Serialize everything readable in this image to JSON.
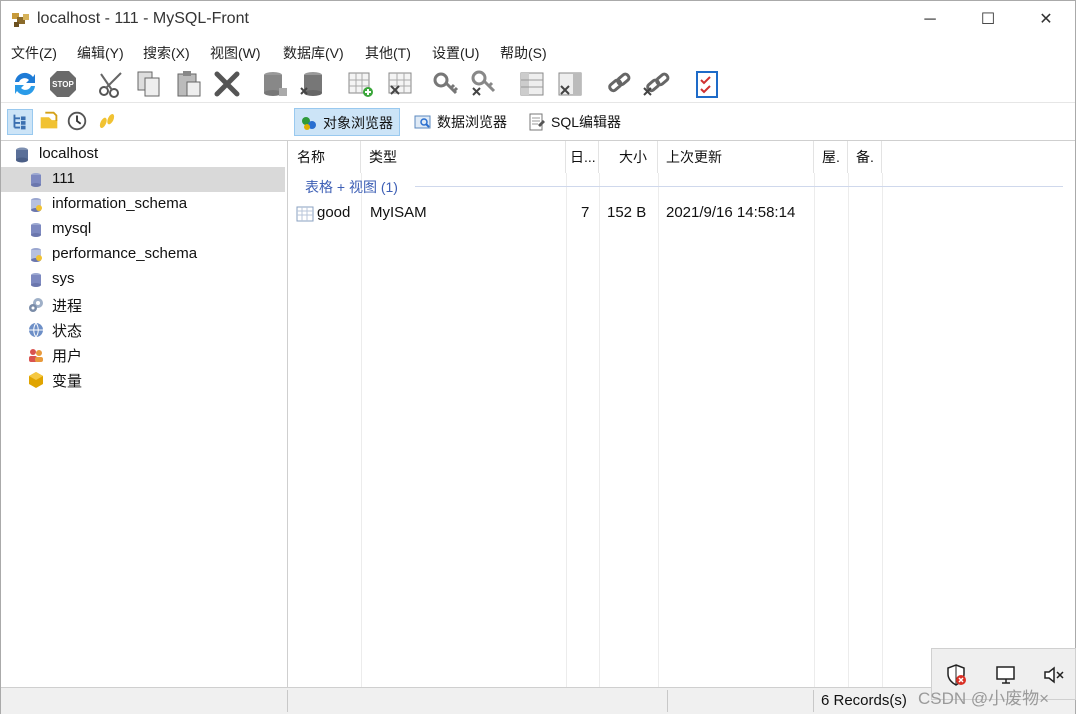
{
  "window": {
    "title": "localhost - 111 - MySQL-Front",
    "minimize": "─",
    "maximize": "☐",
    "close": "✕"
  },
  "menu": [
    "文件(Z)",
    "编辑(Y)",
    "搜索(X)",
    "视图(W)",
    "数据库(V)",
    "其他(T)",
    "设置(U)",
    "帮助(S)"
  ],
  "toolbar": {
    "icons": [
      "refresh-icon",
      "stop-icon",
      "cut-icon",
      "copy-icon",
      "paste-icon",
      "delete-icon",
      "database-add-icon",
      "database-drop-icon",
      "table-add-icon",
      "table-drop-icon",
      "key-add-icon",
      "key-drop-icon",
      "field-add-icon",
      "field-drop-icon",
      "link-add-icon",
      "link-drop-icon",
      "properties-icon"
    ]
  },
  "view_tabs": {
    "object_browser": "对象浏览器",
    "data_browser": "数据浏览器",
    "sql_editor": "SQL编辑器"
  },
  "tree": {
    "root": "localhost",
    "items": [
      {
        "label": "111",
        "icon": "database-icon"
      },
      {
        "label": "information_schema",
        "icon": "system-database-icon"
      },
      {
        "label": "mysql",
        "icon": "database-icon"
      },
      {
        "label": "performance_schema",
        "icon": "system-database-icon"
      },
      {
        "label": "sys",
        "icon": "database-icon"
      },
      {
        "label": "进程",
        "icon": "processes-icon"
      },
      {
        "label": "状态",
        "icon": "status-icon"
      },
      {
        "label": "用户",
        "icon": "users-icon"
      },
      {
        "label": "变量",
        "icon": "variables-icon"
      }
    ]
  },
  "list": {
    "columns": [
      "名称",
      "类型",
      "日...",
      "大小",
      "上次更新",
      "屋.",
      "备."
    ],
    "group_label": "表格 + 视图 (1)",
    "rows": [
      {
        "name": "good",
        "type": "MyISAM",
        "records": "7",
        "size": "152 B",
        "updated": "2021/9/16 14:58:14"
      }
    ]
  },
  "status": {
    "records": "6 Records(s)"
  },
  "watermark": "CSDN @小废物×",
  "colors": {
    "selection": "#d9d9d9",
    "active_tab": "#cce4f7",
    "group_text": "#3d5fb5"
  }
}
